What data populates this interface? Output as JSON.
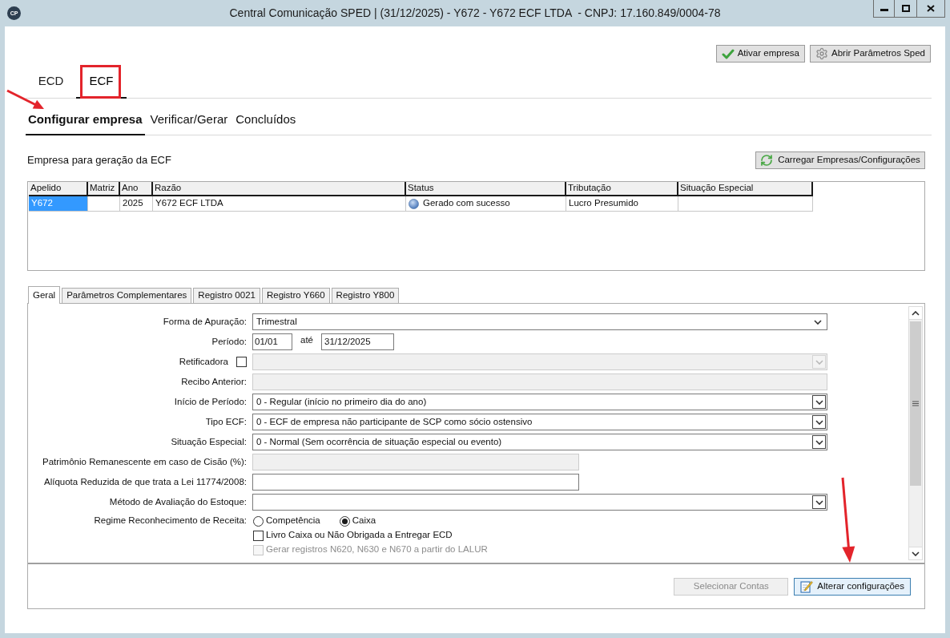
{
  "window": {
    "logo": "CP",
    "title": "Central Comunicação SPED | (31/12/2025) - Y672 - Y672 ECF LTDA  - CNPJ: 17.160.849/0004-78"
  },
  "toolbar": [
    {
      "label": "Ativar empresa"
    },
    {
      "label": "Abrir Parâmetros Sped"
    }
  ],
  "module_tabs": [
    {
      "label": "ECD",
      "selected": false
    },
    {
      "label": "ECF",
      "selected": true
    }
  ],
  "section_tabs": [
    {
      "label": "Configurar empresa",
      "selected": true
    },
    {
      "label": "Verificar/Gerar",
      "selected": false
    },
    {
      "label": "Concluídos",
      "selected": false
    }
  ],
  "companies": {
    "caption": "Empresa para geração da ECF",
    "load_button": "Carregar Empresas/Configurações",
    "columns": [
      "Apelido",
      "Matriz",
      "Ano",
      "Razão",
      "Status",
      "Tributação",
      "Situação Especial"
    ],
    "rows": [
      {
        "selected": true,
        "cells": [
          "Y672",
          null,
          "2025",
          "Y672 ECF LTDA",
          "Gerado com sucesso",
          "Lucro Presumido",
          null
        ]
      }
    ]
  },
  "detail_tabs": [
    {
      "label": "Geral",
      "selected": true
    },
    {
      "label": "Parâmetros Complementares",
      "selected": false
    },
    {
      "label": "Registro 0021",
      "selected": false
    },
    {
      "label": "Registro Y660",
      "selected": false
    },
    {
      "label": "Registro Y800",
      "selected": false
    }
  ],
  "form": [
    {
      "kind": "select",
      "label": "Forma de Apuração:",
      "value": "Trimestral",
      "disabled": false
    },
    {
      "kind": "period",
      "label": "Período:",
      "from": "01/01",
      "separator": "até",
      "to": "31/12/2025"
    },
    {
      "kind": "combo",
      "label": "Retificadora",
      "toggle": {
        "checked": false
      },
      "disabled": true
    },
    {
      "kind": "text",
      "label": "Recibo Anterior:",
      "disabled": true
    },
    {
      "kind": "combo",
      "label": "Início de Período:",
      "value": "0 - Regular (início no primeiro dia do ano)",
      "disabled": false
    },
    {
      "kind": "combo",
      "label": "Tipo ECF:",
      "value": "0 - ECF de empresa não participante de SCP como sócio ostensivo",
      "disabled": false
    },
    {
      "kind": "combo",
      "label": "Situação Especial:",
      "value": "0 - Normal (Sem ocorrência de situação especial ou evento)",
      "disabled": false
    },
    {
      "kind": "number",
      "label": "Patrimônio Remanescente em caso de Cisão (%):",
      "disabled": true
    },
    {
      "kind": "number",
      "label": "Alíquota Reduzida de que trata a Lei 11774/2008:",
      "disabled": false
    },
    {
      "kind": "combo",
      "label": "Método de Avaliação do Estoque:",
      "disabled": false
    },
    {
      "kind": "radio",
      "label": "Regime Reconhecimento de Receita:",
      "options": [
        {
          "label": "Competência",
          "selected": false
        },
        {
          "label": "Caixa",
          "selected": true
        }
      ]
    },
    {
      "kind": "checkbox",
      "label": "Livro Caixa ou Não Obrigada a Entregar ECD",
      "checked": false,
      "disabled": false
    },
    {
      "kind": "checkbox",
      "label": "Gerar registros N620, N630 e N670 a partir do LALUR",
      "checked": false,
      "disabled": true
    }
  ],
  "footer_buttons": [
    {
      "label": "Selecionar Contas",
      "disabled": true,
      "default": false
    },
    {
      "label": "Alterar configurações",
      "disabled": false,
      "default": true
    }
  ]
}
